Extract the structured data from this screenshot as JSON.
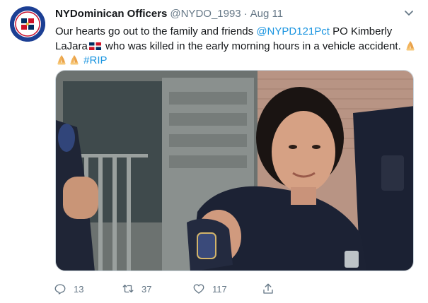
{
  "tweet": {
    "author_name": "NYDominican Officers",
    "handle": "@NYDO_1993",
    "separator": "·",
    "date": "Aug 11",
    "text_part1": "Our hearts go out to the family and friends ",
    "mention": "@NYPD121Pct",
    "text_part2": " PO Kimberly LaJara",
    "text_part3": " who was killed in the early morning hours in a vehicle accident. ",
    "hashtag": "#RIP"
  },
  "actions": {
    "reply_count": "13",
    "retweet_count": "37",
    "like_count": "117"
  },
  "icons": {
    "avatar": "nydo-logo-avatar",
    "caret": "chevron-down-icon",
    "flag": "dominican-republic-flag-emoji",
    "pray": "folded-hands-emoji",
    "reply": "reply-icon",
    "retweet": "retweet-icon",
    "like": "heart-icon",
    "share": "share-icon"
  },
  "colors": {
    "link": "#1b95e0",
    "secondary_text": "#657786",
    "primary_text": "#14171a",
    "avatar_bg": "#1c3f94"
  }
}
